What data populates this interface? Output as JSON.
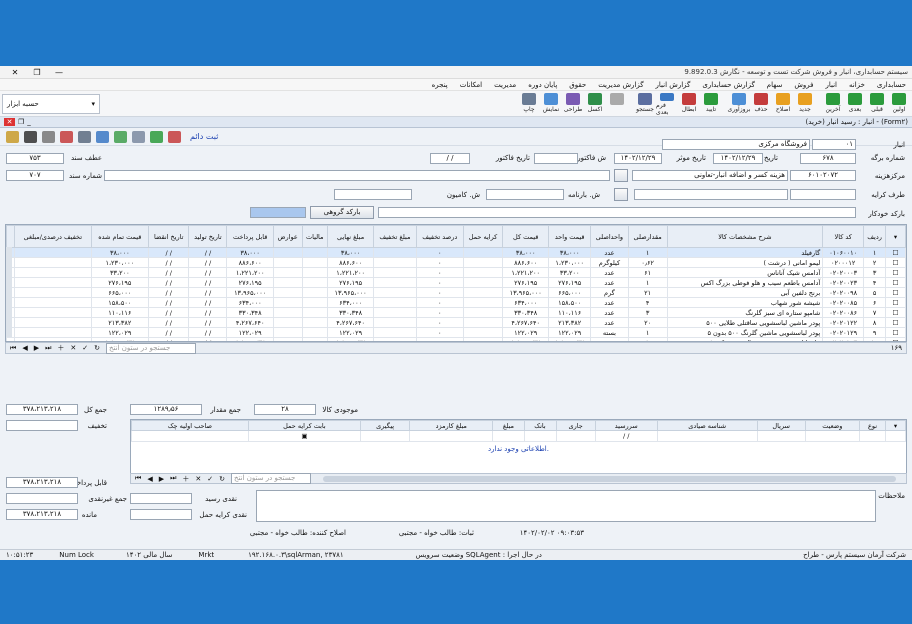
{
  "title": "سیستم حسابداری، انبار و فروش شرکت تست و توسعه - نگارش 9.892.0.3",
  "menu": [
    "حسابداری",
    "خزانه",
    "انبار",
    "فروش",
    "سهام",
    "گزارش حسابداری",
    "گزارش انبار",
    "گزارش مدیریت",
    "حقوق",
    "پایان دوره",
    "مدیریت",
    "امکانات",
    "پنجره"
  ],
  "ribbon": [
    "اولین",
    "قبلی",
    "بعدی",
    "آخرین",
    "جدید",
    "اصلاح",
    "حذف",
    "بروزآوری",
    "تایید",
    "ابطال",
    "فرم بعدی",
    "جستجو",
    "",
    "اکسل",
    "طراحی",
    "نمایش",
    "چاپ"
  ],
  "ribbon_box": "حسبه ابزار",
  "form_title": "انبار : رسید انبار (خرید) - (Form۲)",
  "ok_label": "ثبت دائم",
  "header": {
    "anbar_label": "انبار",
    "anbar_code": "۰۱",
    "anbar_name": "فروشگاه مرکزی",
    "barge_label": "شماره برگه",
    "barge_no": "۶۷۸",
    "date_label": "تاریخ برگه",
    "date_val": "۱۴۰۲/۱۲/۲۹",
    "eff_label": "تاریخ موثر",
    "eff_val": "۱۴۰۲/۱۲/۲۹",
    "inv_no_label": "ش فاکتور",
    "inv_date_label": "تاریخ فاکتور",
    "inv_date_val": "/ /",
    "ref_label": "عطف سند",
    "ref_val": "۷۵۳",
    "center_label": "مرکزهزینه",
    "center_code": "۶۰۱۰۲۰۷۲",
    "center_name": "هزینه کسر و اضافه انبار-تعاونی",
    "doc_label": "شماره سند",
    "doc_val": "۷۰۷",
    "party_label": "طرف کرایه",
    "bill_label": "ش. بارنامه",
    "truck_label": "ش. کامیون",
    "barcode_label": "بارکد خودکار",
    "barcode_btn": "بارکد گروهی"
  },
  "grid": {
    "headers": [
      "ردیف",
      "کد کالا",
      "شرح مشخصات کالا",
      "مقدارصلی",
      "واحداصلی",
      "قیمت واحد",
      "قیمت کل",
      "کرایه حمل",
      "درصد تخفیف",
      "مبلغ تخفیف",
      "مبلغ نهایی",
      "مالیات",
      "عوارض",
      "قابل پرداخت",
      "تاریخ تولید",
      "تاریخ انقضا",
      "قیمت تمام شده",
      "تخفیف درصدی/مبلغی"
    ],
    "rows": [
      [
        "۱",
        "۰۱۰۶۰۰۱۰",
        "گارفیلد",
        "۱",
        "عدد",
        "۳۸،۰۰۰",
        "۳۸،۰۰۰",
        "",
        "۰",
        "",
        "۳۸،۰۰۰",
        "",
        "",
        "۳۸،۰۰۰",
        "/ /",
        "/ /",
        "۳۸،۰۰۰",
        ""
      ],
      [
        "۲",
        "۰۲۰۰۰۱۲",
        "لیمو امانی ( درشت )",
        "۰٫۶۲",
        "کیلوگرم",
        "۱،۲۳۰،۰۰۰",
        "۸۸۶،۶۰۰",
        "",
        "۰",
        "",
        "۸۸۶،۶۰۰",
        "",
        "",
        "۸۸۶،۶۰۰",
        "/ /",
        "/ /",
        "۱،۲۳۰،۰۰۰",
        ""
      ],
      [
        "۳",
        "۰۲۰۲۰۰۰۳",
        "آدامس شیک آناناس",
        "۶۱",
        "عدد",
        "۳۳،۲۰۰",
        "۱،۲۲۱،۲۰۰",
        "",
        "۰",
        "",
        "۱،۲۲۱،۲۰۰",
        "",
        "",
        "۱،۲۲۱،۲۰۰",
        "/ /",
        "/ /",
        "۳۳،۲۰۰",
        ""
      ],
      [
        "۴",
        "۰۲۰۲۰۰۲۳",
        "آدامس باطعم سیب و هلو فوطی بزرگ اکس",
        "۱",
        "عدد",
        "۲۷۶،۱۹۵",
        "۲۷۶،۱۹۵",
        "",
        "۰",
        "",
        "۲۷۶،۱۹۵",
        "",
        "",
        "۲۷۶،۱۹۵",
        "/ /",
        "/ /",
        "۲۷۶،۱۹۵",
        ""
      ],
      [
        "۵",
        "۰۲۰۲۰۰۹۸",
        "برنج دلفین آبی",
        "۲۱",
        "گرم",
        "۶۶۵،۰۰۰",
        "۱۳،۹۶۵،۰۰۰",
        "",
        "۰",
        "",
        "۱۳،۹۶۵،۰۰۰",
        "",
        "",
        "۱۳،۹۶۵،۰۰۰",
        "/ /",
        "/ /",
        "۶۶۵،۰۰۰",
        ""
      ],
      [
        "۶",
        "۰۲۰۲۰۰۸۵",
        "شیشه شور شهاب",
        "۴",
        "عدد",
        "۱۵۸،۵۰۰",
        "۶۳۴،۰۰۰",
        "",
        "۰",
        "",
        "۶۳۴،۰۰۰",
        "",
        "",
        "۶۳۴،۰۰۰",
        "/ /",
        "/ /",
        "۱۵۸،۵۰۰",
        ""
      ],
      [
        "۷",
        "۰۲۰۲۰۰۸۶",
        "شامپو ستاره ای سبز گلرنگ",
        "۳",
        "عدد",
        "۱۱۰،۱۱۶",
        "۳۳۰،۳۴۸",
        "",
        "۰",
        "",
        "۳۳۰،۳۴۸",
        "",
        "",
        "۳۳۰،۳۴۸",
        "/ /",
        "/ /",
        "۱۱۰،۱۱۶",
        ""
      ],
      [
        "۸",
        "۰۲۰۲۰۱۲۲",
        "پودر ماشین لباسشویی ساقتلی طلایی ۵۰۰",
        "۲۰",
        "عدد",
        "۲۱۳،۳۸۲",
        "۴،۲۶۷،۶۴۰",
        "",
        "۰",
        "",
        "۴،۲۶۷،۶۴۰",
        "",
        "",
        "۴،۲۶۷،۶۴۰",
        "/ /",
        "/ /",
        "۲۱۳،۳۸۲",
        ""
      ],
      [
        "۹",
        "۰۲۰۲۰۱۲۹",
        "پودر لباسشویی ماشین گلرنگ ۵۰۰ بدون ۵",
        "۱",
        "بسته",
        "۱۲۲،۰۲۹",
        "۱۲۲،۰۲۹",
        "",
        "۰",
        "",
        "۱۲۲،۰۲۹",
        "",
        "",
        "۱۲۲،۰۲۹",
        "/ /",
        "/ /",
        "۱۲۲،۰۲۹",
        ""
      ],
      [
        "۱۰",
        "۰۲۰۲۰۱۵۳",
        "مایع لباسشویی مخصوص البسه مشکی ۱ س",
        "۱",
        "عدد",
        "۱،۱۹۹،۹۳۲",
        "۱،۱۹۹،۹۳۲",
        "",
        "۰",
        "",
        "۱،۱۹۹،۹۳۲",
        "",
        "",
        "۱،۱۹۹،۹۳۲",
        "/ /",
        "/ /",
        "۱،۱۹۹،۹۳۲",
        ""
      ],
      [
        "۱۱",
        "۰۲۰۲۰۱۶۰",
        "شامپو تخم مرغی ۹۰۰ گرمی گلرنگ",
        "۵",
        "عدد",
        "۳۶۰،۸۳۰",
        "۱،۸۰۴،۱۵۰",
        "",
        "۰",
        "",
        "۱،۸۰۴،۱۵۰",
        "",
        "",
        "۱،۸۰۴،۱۵۰",
        "/ /",
        "/ /",
        "۳۶۰،۸۳۰",
        ""
      ]
    ]
  },
  "grid_footer": {
    "count": "۱۶۹",
    "search_placeholder": "جستجو در ستون انتخ"
  },
  "totals": {
    "sum_label": "جمع کل",
    "sum_val": "۳۷۸،۲۱۳،۲۱۸",
    "qty_label": "جمع مقدار",
    "qty_val": "۱۲۸۹٫۵۶",
    "stock_label": "موجودی کالا",
    "stock_val": "۲۸",
    "discount_label": "تخفیف",
    "payable_label": "قابل پرداخت",
    "payable_val": "۳۷۸،۲۱۳،۲۱۸",
    "noncash_label": "جمع غیرنقدی",
    "remain_label": "مانده",
    "remain_val": "۳۷۸،۲۱۳،۲۱۸",
    "cash_recv_label": "نقدی رسید",
    "cash_freight_label": "نقدی کرایه حمل",
    "notes_label": "ملاحظات"
  },
  "sub": {
    "headers": [
      "نوع",
      "وضعیت",
      "سریال",
      "شناسه صیادی",
      "سررسید",
      "جاری",
      "بانک",
      "مبلغ",
      "مبلغ کارمزد",
      "پیگیری",
      "بابت کرایه حمل",
      "صاحب اولیه چک"
    ],
    "date_val": "/ /",
    "nodata": "اطلاعاتی وجود ندارد.",
    "search_placeholder": "جستجو در ستون انتخ"
  },
  "audit": {
    "created": "ثبات: طالب خواه - مجتبی",
    "created_ts": "۱۴۰۲/۰۲/۰۲ ۰۹:۰۳:۵۳",
    "edited": "اصلاح کننده: طالب خواه - مجتبی"
  },
  "status": {
    "company": "شرکت آرمان سیستم پارس - طراح",
    "sql": "وضعیت سرویس SQLAgent : در حال اجرا",
    "server": "۱۹۲.۱۶۸.۰.۳\\sqlArman, ۲۳۷۸۱",
    "mode": "Mrkt",
    "year": "سال مالی ۱۴۰۲",
    "numlock": "Num Lock",
    "time": "۱۰:۵۱:۲۳"
  }
}
